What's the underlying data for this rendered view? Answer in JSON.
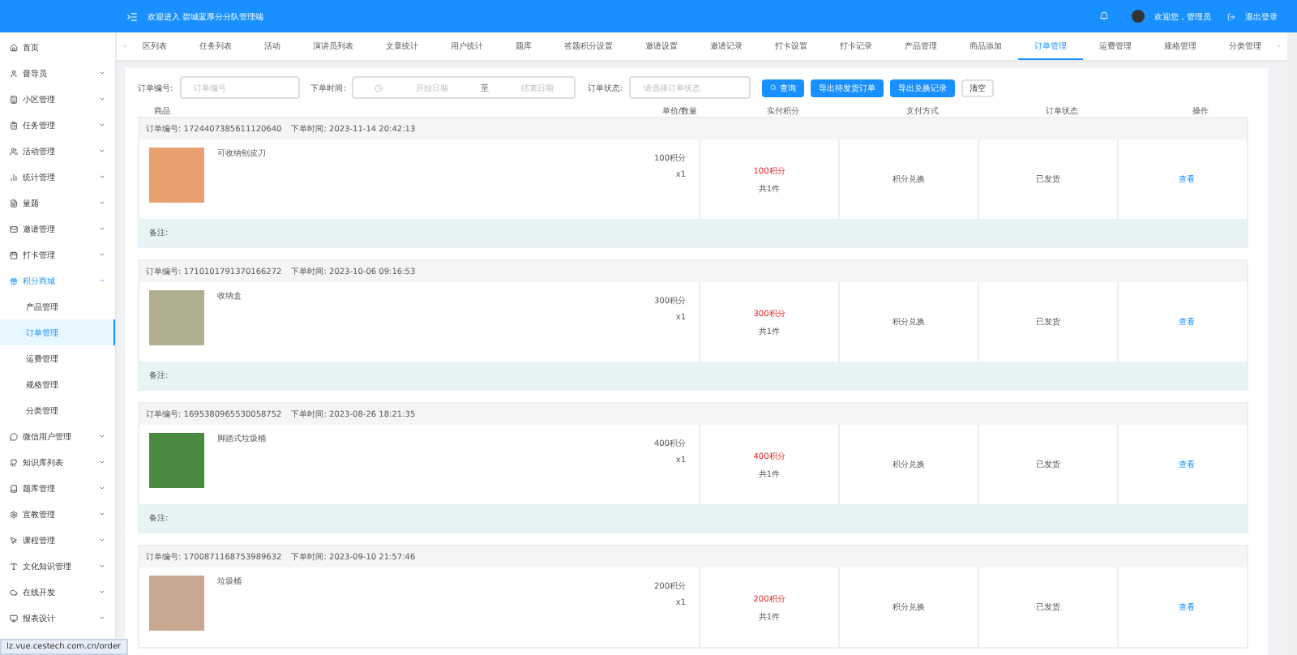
{
  "header": {
    "title": "欢迎进入 碧城蓝厚分分队管理端",
    "user": "欢迎您，管理员",
    "logout": "退出登录"
  },
  "sidebar": {
    "items": [
      {
        "label": "首页",
        "selected": false
      },
      {
        "label": "督导员",
        "selected": false,
        "expanded": false
      },
      {
        "label": "小区管理",
        "selected": false,
        "expanded": false
      },
      {
        "label": "任务管理",
        "selected": false,
        "expanded": false
      },
      {
        "label": "活动管理",
        "selected": false,
        "expanded": false
      },
      {
        "label": "统计管理",
        "selected": false,
        "expanded": false
      },
      {
        "label": "量题",
        "selected": false,
        "expanded": false
      },
      {
        "label": "邀请管理",
        "selected": false,
        "expanded": false
      },
      {
        "label": "打卡管理",
        "selected": false,
        "expanded": false
      },
      {
        "label": "积分商城",
        "selected": true,
        "expanded": true,
        "children": [
          {
            "label": "产品管理",
            "selected": false
          },
          {
            "label": "订单管理",
            "selected": true
          },
          {
            "label": "运费管理",
            "selected": false
          },
          {
            "label": "规格管理",
            "selected": false
          },
          {
            "label": "分类管理",
            "selected": false
          }
        ]
      },
      {
        "label": "微信用户管理",
        "selected": false,
        "expanded": false
      },
      {
        "label": "知识库列表",
        "selected": false,
        "expanded": false
      },
      {
        "label": "题库管理",
        "selected": false,
        "expanded": false
      },
      {
        "label": "宣教管理",
        "selected": false,
        "expanded": false
      },
      {
        "label": "课程管理",
        "selected": false,
        "expanded": false
      },
      {
        "label": "文化知识管理",
        "selected": false,
        "expanded": false
      },
      {
        "label": "在线开发",
        "selected": false,
        "expanded": false
      },
      {
        "label": "报表设计",
        "selected": false,
        "expanded": false
      }
    ]
  },
  "tabs": [
    {
      "label": "区列表",
      "selected": false
    },
    {
      "label": "任务列表",
      "selected": false
    },
    {
      "label": "活动",
      "selected": false
    },
    {
      "label": "演讲员列表",
      "selected": false
    },
    {
      "label": "文章统计",
      "selected": false
    },
    {
      "label": "用户统计",
      "selected": false
    },
    {
      "label": "题库",
      "selected": false
    },
    {
      "label": "答题积分设置",
      "selected": false
    },
    {
      "label": "邀请设置",
      "selected": false
    },
    {
      "label": "邀请记录",
      "selected": false
    },
    {
      "label": "打卡设置",
      "selected": false
    },
    {
      "label": "打卡记录",
      "selected": false
    },
    {
      "label": "产品管理",
      "selected": false
    },
    {
      "label": "商品添加",
      "selected": false
    },
    {
      "label": "订单管理",
      "selected": true
    },
    {
      "label": "运费管理",
      "selected": false
    },
    {
      "label": "规格管理",
      "selected": false
    },
    {
      "label": "分类管理",
      "selected": false
    }
  ],
  "filters": {
    "order_no": {
      "label": "订单编号:",
      "placeholder": "订单编号"
    },
    "time": {
      "label": "下单时间:",
      "start_placeholder": "开始日期",
      "separator": "至",
      "end_placeholder": "结束日期"
    },
    "status": {
      "label": "订单状态:",
      "placeholder": "请选择订单状态"
    }
  },
  "buttons": [
    {
      "label": "查询",
      "kind": "search"
    },
    {
      "label": "导出待发货订单",
      "kind": "primary"
    },
    {
      "label": "导出兑换记录",
      "kind": "primary"
    },
    {
      "label": "清空",
      "kind": "plain"
    }
  ],
  "table": {
    "columns": [
      "商品",
      "单价/数量",
      "实付积分",
      "支付方式",
      "订单状态",
      "操作"
    ],
    "orders": [
      {
        "no_label": "订单编号:",
        "no": "1724407385611120640",
        "time_label": "下单时间:",
        "time": "2023-11-14 20:42:13",
        "product": "可收纳刨皮刀",
        "price": "100积分",
        "qty": "x1",
        "paid": "100积分",
        "count": "共1件",
        "payment": "积分兑换",
        "status": "已发货",
        "action": "查看",
        "remark": "备注:"
      },
      {
        "no_label": "订单编号:",
        "no": "1710101791370166272",
        "time_label": "下单时间:",
        "time": "2023-10-06 09:16:53",
        "product": "收纳盒",
        "price": "300积分",
        "qty": "x1",
        "paid": "300积分",
        "count": "共1件",
        "payment": "积分兑换",
        "status": "已发货",
        "action": "查看",
        "remark": "备注:"
      },
      {
        "no_label": "订单编号:",
        "no": "1695380965530058752",
        "time_label": "下单时间:",
        "time": "2023-08-26 18:21:35",
        "product": "脚踏式垃圾桶",
        "price": "400积分",
        "qty": "x1",
        "paid": "400积分",
        "count": "共1件",
        "payment": "积分兑换",
        "status": "已发货",
        "action": "查看",
        "remark": "备注:"
      },
      {
        "no_label": "订单编号:",
        "no": "1700871168753989632",
        "time_label": "下单时间:",
        "time": "2023-09-10 21:57:46",
        "product": "垃圾桶",
        "price": "200积分",
        "qty": "x1",
        "paid": "200积分",
        "count": "共1件",
        "payment": "积分兑换",
        "status": "已发货",
        "action": "查看"
      }
    ]
  },
  "status_bar": {
    "url": "lz.vue.cestech.com.cn/order"
  }
}
